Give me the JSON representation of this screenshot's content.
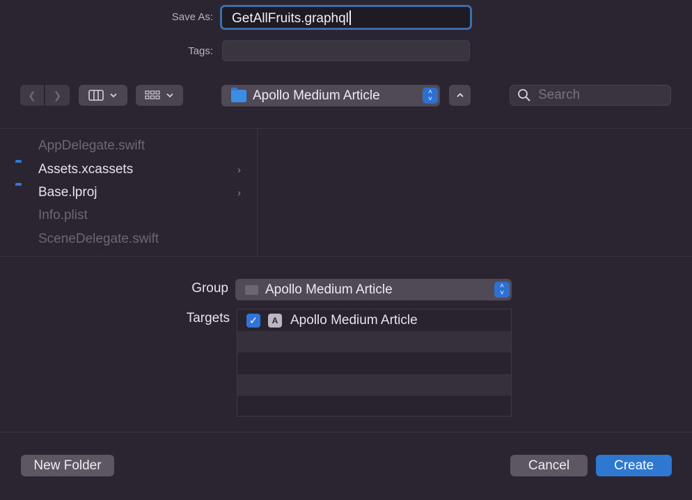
{
  "form": {
    "save_as_label": "Save As:",
    "save_as_value": "GetAllFruits.graphql",
    "tags_label": "Tags:",
    "tags_value": ""
  },
  "toolbar": {
    "location": "Apollo Medium Article",
    "search_placeholder": "Search"
  },
  "files": [
    {
      "name": "AppDelegate.swift",
      "type": "file",
      "enabled": false
    },
    {
      "name": "Assets.xcassets",
      "type": "folder",
      "enabled": true
    },
    {
      "name": "Base.lproj",
      "type": "folder",
      "enabled": true
    },
    {
      "name": "Info.plist",
      "type": "file",
      "enabled": false
    },
    {
      "name": "SceneDelegate.swift",
      "type": "file",
      "enabled": false
    }
  ],
  "options": {
    "group_label": "Group",
    "group_value": "Apollo Medium Article",
    "targets_label": "Targets",
    "targets": [
      {
        "name": "Apollo Medium Article",
        "checked": true
      }
    ]
  },
  "buttons": {
    "new_folder": "New Folder",
    "cancel": "Cancel",
    "create": "Create"
  },
  "colors": {
    "background": "#2a2530",
    "accent": "#2f78d2",
    "folder": "#3a8ee6"
  }
}
